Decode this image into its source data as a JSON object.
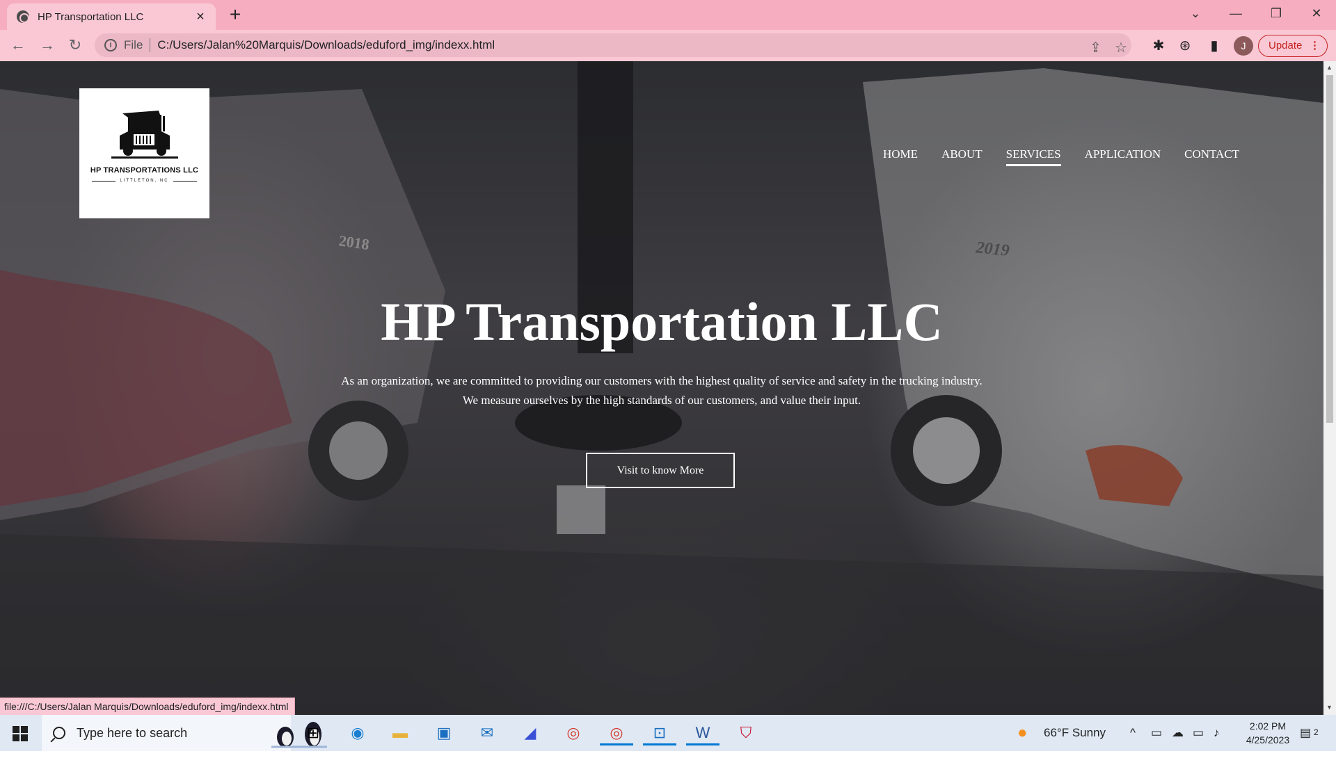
{
  "browser": {
    "tab_title": "HP Transportation LLC",
    "new_tab": "+",
    "tab_close": "×",
    "scheme": "File",
    "url": "C:/Users/Jalan%20Marquis/Downloads/eduford_img/indexx.html",
    "profile_initial": "J",
    "update_label": "Update",
    "status_url": "file:///C:/Users/Jalan Marquis/Downloads/eduford_img/indexx.html"
  },
  "page": {
    "logo": {
      "name": "HP TRANSPORTATIONS LLC",
      "location": "LITTLETON, NC"
    },
    "nav": [
      {
        "label": "HOME"
      },
      {
        "label": "ABOUT"
      },
      {
        "label": "SERVICES"
      },
      {
        "label": "APPLICATION"
      },
      {
        "label": "CONTACT"
      }
    ],
    "active_nav": "SERVICES",
    "hero": {
      "title": "HP Transportation LLC",
      "line1": "As an organization, we are committed to providing our customers with the highest quality of service and safety in the trucking industry.",
      "line2": "We measure ourselves by the high standards of our customers, and value their input.",
      "button": "Visit to know More"
    },
    "photo_text": {
      "left_truck_year": "2018",
      "right_truck_year": "2019"
    }
  },
  "taskbar": {
    "search_placeholder": "Type here to search",
    "weather": "66°F  Sunny",
    "time": "2:02 PM",
    "date": "4/25/2023",
    "notifications": "2"
  },
  "colors": {
    "chrome_tabbar": "#f7adc0",
    "chrome_toolbar": "#f9c8d4",
    "update_accent": "#c5221f",
    "taskbar": "#dfe8f3"
  }
}
